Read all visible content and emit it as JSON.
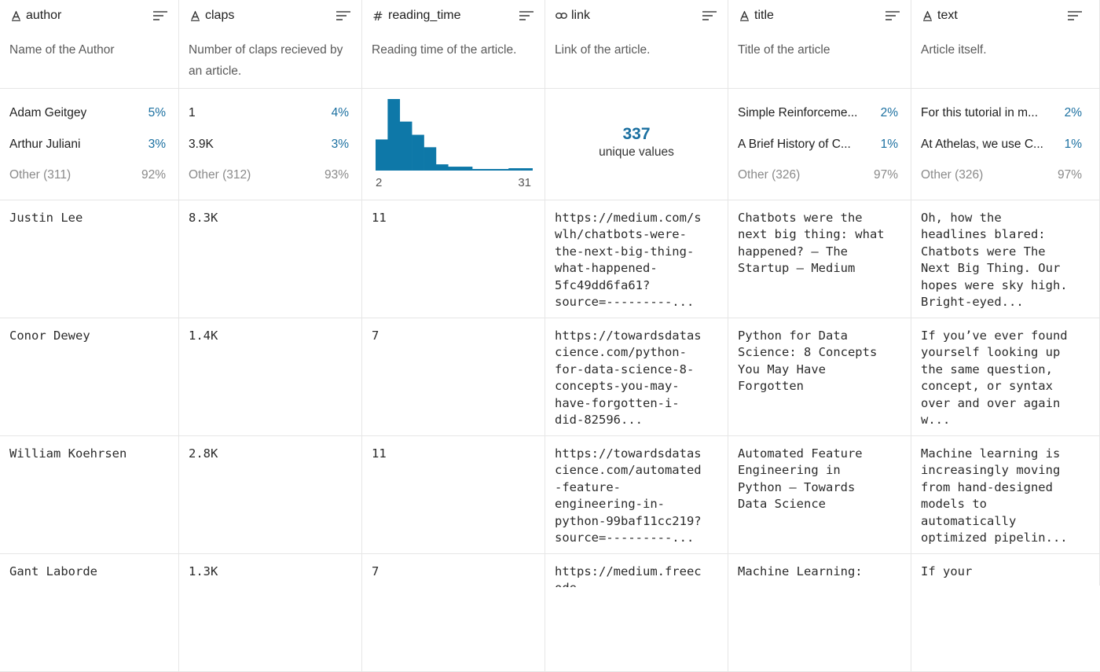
{
  "columns": [
    {
      "name": "author",
      "type_icon": "A",
      "description": "Name of the Author",
      "stats": {
        "top": [
          {
            "label": "Adam Geitgey",
            "pct": "5%"
          },
          {
            "label": "Arthur Juliani",
            "pct": "3%"
          }
        ],
        "other": {
          "label": "Other (311)",
          "pct": "92%"
        }
      }
    },
    {
      "name": "claps",
      "type_icon": "A",
      "description": "Number of claps recieved by an article.",
      "stats": {
        "top": [
          {
            "label": "1",
            "pct": "4%"
          },
          {
            "label": "3.9K",
            "pct": "3%"
          }
        ],
        "other": {
          "label": "Other (312)",
          "pct": "93%"
        }
      }
    },
    {
      "name": "reading_time",
      "type_icon": "#",
      "description": "Reading time of the article.",
      "histogram": {
        "min_label": "2",
        "max_label": "31"
      }
    },
    {
      "name": "link",
      "type_icon": "link",
      "description": "Link of the article.",
      "unique": {
        "count": "337",
        "label": "unique values"
      }
    },
    {
      "name": "title",
      "type_icon": "A",
      "description": "Title of the article",
      "stats": {
        "top": [
          {
            "label": "Simple Reinforceme...",
            "pct": "2%"
          },
          {
            "label": "A Brief History of C...",
            "pct": "1%"
          }
        ],
        "other": {
          "label": "Other (326)",
          "pct": "97%"
        }
      }
    },
    {
      "name": "text",
      "type_icon": "A",
      "description": "Article itself.",
      "stats": {
        "top": [
          {
            "label": "For this tutorial in m...",
            "pct": "2%"
          },
          {
            "label": "At Athelas, we use C...",
            "pct": "1%"
          }
        ],
        "other": {
          "label": "Other (326)",
          "pct": "97%"
        }
      }
    }
  ],
  "chart_data": {
    "type": "bar",
    "title": "",
    "xlabel": "",
    "ylabel": "",
    "categories": [
      "2-4",
      "4-6",
      "6-8",
      "8-10",
      "10-12",
      "12-14",
      "14-16",
      "16-18",
      "18-20",
      "20-22",
      "22-24",
      "24-26",
      "26-31"
    ],
    "values": [
      40,
      92,
      63,
      46,
      30,
      8,
      5,
      5,
      1,
      1,
      1,
      3,
      3
    ],
    "x_range_labels": [
      "2",
      "31"
    ],
    "color": "#0e78a8"
  },
  "rows": [
    [
      "Justin Lee",
      "8.3K",
      "11",
      "https://medium.com/s\nwlh/chatbots-were-\nthe-next-big-thing-\nwhat-happened-\n5fc49dd6fa61?\nsource=---------...",
      "Chatbots were the\nnext big thing: what\nhappened? – The\nStartup – Medium",
      "Oh, how the\nheadlines blared:\nChatbots were The\nNext Big Thing. Our\nhopes were sky high.\nBright-eyed..."
    ],
    [
      "Conor Dewey",
      "1.4K",
      "7",
      "https://towardsdatas\ncience.com/python-\nfor-data-science-8-\nconcepts-you-may-\nhave-forgotten-i-\ndid-82596...",
      "Python for Data\nScience: 8 Concepts\nYou May Have\nForgotten",
      "If you’ve ever found\nyourself looking up\nthe same question,\nconcept, or syntax\nover and over again\nw..."
    ],
    [
      "William Koehrsen",
      "2.8K",
      "11",
      "https://towardsdatas\ncience.com/automated\n-feature-\nengineering-in-\npython-99baf11cc219?\nsource=---------...",
      "Automated Feature\nEngineering in\nPython – Towards\nData Science",
      "Machine learning is\nincreasingly moving\nfrom hand-designed\nmodels to\nautomatically\noptimized pipelin..."
    ],
    [
      "Gant Laborde",
      "1.3K",
      "7",
      "https://medium.freec\node...",
      "Machine Learning:\n...",
      "If your\n..."
    ]
  ],
  "colors": {
    "accent": "#1a6fa0",
    "bar": "#0e78a8",
    "border": "#e6e6e6",
    "muted": "#8a8a8a"
  }
}
